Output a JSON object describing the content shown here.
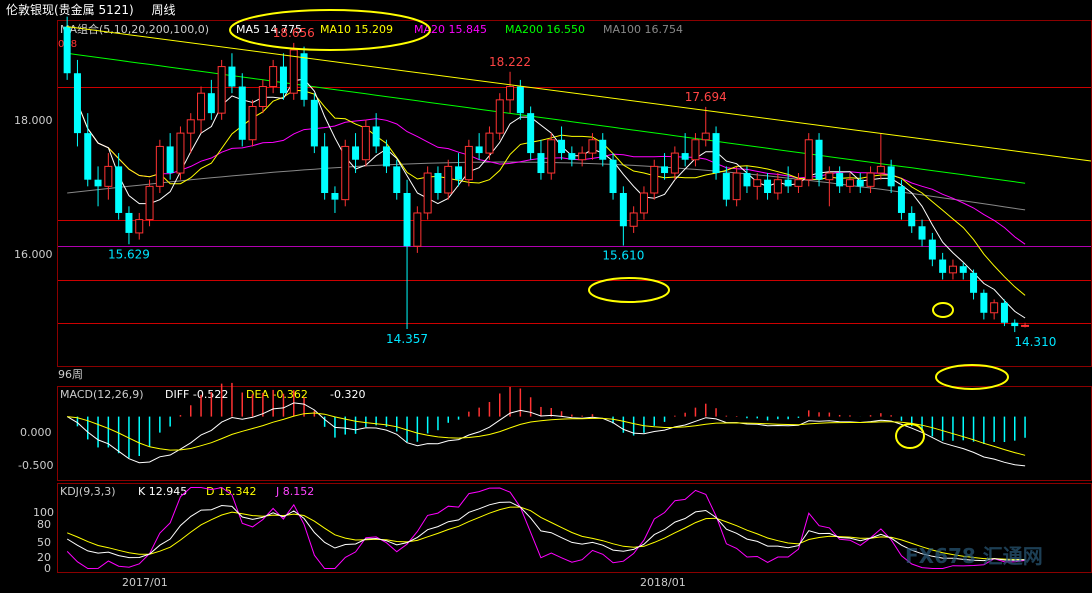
{
  "window": {
    "instrument": "伦敦银现(贵金属 5121)",
    "period": "周线"
  },
  "price_panel": {
    "ma_group_label": "MA组合(5,10,20,200,100,0)",
    "ma_values": [
      {
        "label": "MA5 14.775",
        "color": "#ffffff"
      },
      {
        "label": "MA10 15.209",
        "color": "#ffff00"
      },
      {
        "label": "MA20 15.845",
        "color": "#ff00ff"
      },
      {
        "label": "MA200 16.550",
        "color": "#00ff00"
      },
      {
        "label": "MA100 16.754",
        "color": "#888888"
      }
    ],
    "corner_label": "018",
    "bars_label": "96周",
    "y_ticks": [
      "18.000",
      "16.000"
    ]
  },
  "macd_panel": {
    "label": "MACD(12,26,9)",
    "diff": "DIFF -0.522",
    "dea": "DEA -0.362",
    "macd": "-0.320",
    "y_ticks": [
      "0.000",
      "-0.500"
    ]
  },
  "kdj_panel": {
    "label": "KDJ(9,3,3)",
    "k": "K 12.945",
    "d": "D 15.342",
    "j": "J 8.152",
    "y_ticks": [
      "100",
      "80",
      "50",
      "20",
      "0"
    ]
  },
  "x_axis": {
    "ticks": [
      "2017/01",
      "2018/01"
    ]
  },
  "watermark": "FX678 汇通网",
  "colors": {
    "up": "#ff3333",
    "down": "#00ffff",
    "ma5": "#ffffff",
    "ma10": "#ffff00",
    "ma20": "#ff00ff",
    "ma200": "#00ff00",
    "ma100": "#888888",
    "ref_line": "#cc0000"
  },
  "chart_data": {
    "type": "candlestick",
    "x_range": [
      "2016/09",
      "2018/07"
    ],
    "price_ylim": [
      13.8,
      19.0
    ],
    "horizontal_lines": [
      18.0,
      16.0,
      15.6,
      15.1,
      14.45
    ],
    "annotations": [
      {
        "text": "18.656",
        "kind": "high",
        "value": 18.656,
        "index": 22
      },
      {
        "text": "18.222",
        "kind": "high",
        "value": 18.222,
        "index": 43
      },
      {
        "text": "17.694",
        "kind": "high",
        "value": 17.694,
        "index": 62
      },
      {
        "text": "15.629",
        "kind": "low",
        "value": 15.629,
        "index": 6
      },
      {
        "text": "14.357",
        "kind": "low",
        "value": 14.357,
        "index": 33
      },
      {
        "text": "15.610",
        "kind": "low",
        "value": 15.61,
        "index": 54
      },
      {
        "text": "14.310",
        "kind": "low",
        "value": 14.31,
        "index": 94
      }
    ],
    "ohlc": [
      [
        18.9,
        19.05,
        18.1,
        18.2
      ],
      [
        18.2,
        18.4,
        17.1,
        17.3
      ],
      [
        17.3,
        17.6,
        16.5,
        16.6
      ],
      [
        16.6,
        16.8,
        16.2,
        16.5
      ],
      [
        16.5,
        17.0,
        16.3,
        16.8
      ],
      [
        16.8,
        17.0,
        16.0,
        16.1
      ],
      [
        16.1,
        16.2,
        15.63,
        15.8
      ],
      [
        15.8,
        16.1,
        15.7,
        16.0
      ],
      [
        16.0,
        16.6,
        15.9,
        16.5
      ],
      [
        16.5,
        17.2,
        16.4,
        17.1
      ],
      [
        17.1,
        17.3,
        16.6,
        16.7
      ],
      [
        16.7,
        17.4,
        16.6,
        17.3
      ],
      [
        17.3,
        17.6,
        17.0,
        17.5
      ],
      [
        17.5,
        18.0,
        17.3,
        17.9
      ],
      [
        17.9,
        18.1,
        17.5,
        17.6
      ],
      [
        17.6,
        18.4,
        17.5,
        18.3
      ],
      [
        18.3,
        18.5,
        17.9,
        18.0
      ],
      [
        18.0,
        18.2,
        17.1,
        17.2
      ],
      [
        17.2,
        17.8,
        17.1,
        17.7
      ],
      [
        17.7,
        18.1,
        17.6,
        18.0
      ],
      [
        18.0,
        18.4,
        17.9,
        18.3
      ],
      [
        18.3,
        18.5,
        17.8,
        17.9
      ],
      [
        17.9,
        18.656,
        17.8,
        18.55
      ],
      [
        18.5,
        18.6,
        17.7,
        17.8
      ],
      [
        17.8,
        17.9,
        17.0,
        17.1
      ],
      [
        17.1,
        17.3,
        16.3,
        16.4
      ],
      [
        16.4,
        16.5,
        16.1,
        16.3
      ],
      [
        16.3,
        17.2,
        16.2,
        17.1
      ],
      [
        17.1,
        17.3,
        16.7,
        16.9
      ],
      [
        16.9,
        17.5,
        16.8,
        17.4
      ],
      [
        17.4,
        17.6,
        17.0,
        17.1
      ],
      [
        17.1,
        17.2,
        16.7,
        16.8
      ],
      [
        16.8,
        16.9,
        16.3,
        16.4
      ],
      [
        16.4,
        16.6,
        14.357,
        15.6
      ],
      [
        15.6,
        16.2,
        15.5,
        16.1
      ],
      [
        16.1,
        16.8,
        16.0,
        16.7
      ],
      [
        16.7,
        16.8,
        16.3,
        16.4
      ],
      [
        16.4,
        16.9,
        16.3,
        16.8
      ],
      [
        16.8,
        17.0,
        16.5,
        16.6
      ],
      [
        16.6,
        17.2,
        16.5,
        17.1
      ],
      [
        17.1,
        17.3,
        16.9,
        17.0
      ],
      [
        17.0,
        17.4,
        16.9,
        17.3
      ],
      [
        17.3,
        17.9,
        17.2,
        17.8
      ],
      [
        17.8,
        18.222,
        17.6,
        18.0
      ],
      [
        18.0,
        18.1,
        17.5,
        17.6
      ],
      [
        17.6,
        17.7,
        16.9,
        17.0
      ],
      [
        17.0,
        17.2,
        16.6,
        16.7
      ],
      [
        16.7,
        17.3,
        16.6,
        17.2
      ],
      [
        17.2,
        17.4,
        16.9,
        17.0
      ],
      [
        17.0,
        17.1,
        16.8,
        16.9
      ],
      [
        16.9,
        17.1,
        16.8,
        17.0
      ],
      [
        17.0,
        17.3,
        16.9,
        17.2
      ],
      [
        17.2,
        17.3,
        16.8,
        16.9
      ],
      [
        16.9,
        17.0,
        16.3,
        16.4
      ],
      [
        16.4,
        16.5,
        15.61,
        15.9
      ],
      [
        15.9,
        16.2,
        15.8,
        16.1
      ],
      [
        16.1,
        16.5,
        16.0,
        16.4
      ],
      [
        16.4,
        16.9,
        16.3,
        16.8
      ],
      [
        16.8,
        17.0,
        16.6,
        16.7
      ],
      [
        16.7,
        17.1,
        16.6,
        17.0
      ],
      [
        17.0,
        17.3,
        16.8,
        16.9
      ],
      [
        16.9,
        17.3,
        16.8,
        17.2
      ],
      [
        17.2,
        17.694,
        17.1,
        17.3
      ],
      [
        17.3,
        17.4,
        16.6,
        16.7
      ],
      [
        16.7,
        16.8,
        16.2,
        16.3
      ],
      [
        16.3,
        16.8,
        16.2,
        16.7
      ],
      [
        16.7,
        16.8,
        16.4,
        16.5
      ],
      [
        16.5,
        16.7,
        16.3,
        16.6
      ],
      [
        16.6,
        16.7,
        16.3,
        16.4
      ],
      [
        16.4,
        16.7,
        16.3,
        16.6
      ],
      [
        16.6,
        16.8,
        16.4,
        16.5
      ],
      [
        16.5,
        16.7,
        16.4,
        16.6
      ],
      [
        16.6,
        17.3,
        16.5,
        17.2
      ],
      [
        17.2,
        17.3,
        16.5,
        16.6
      ],
      [
        16.6,
        16.8,
        16.2,
        16.7
      ],
      [
        16.7,
        16.8,
        16.4,
        16.5
      ],
      [
        16.5,
        16.7,
        16.4,
        16.6
      ],
      [
        16.6,
        16.7,
        16.4,
        16.5
      ],
      [
        16.5,
        16.8,
        16.4,
        16.7
      ],
      [
        16.7,
        17.3,
        16.6,
        16.8
      ],
      [
        16.8,
        16.9,
        16.4,
        16.5
      ],
      [
        16.5,
        16.6,
        16.0,
        16.1
      ],
      [
        16.1,
        16.2,
        15.8,
        15.9
      ],
      [
        15.9,
        16.0,
        15.6,
        15.7
      ],
      [
        15.7,
        15.8,
        15.3,
        15.4
      ],
      [
        15.4,
        15.5,
        15.1,
        15.2
      ],
      [
        15.2,
        15.4,
        15.1,
        15.3
      ],
      [
        15.3,
        15.35,
        15.1,
        15.2
      ],
      [
        15.2,
        15.25,
        14.8,
        14.9
      ],
      [
        14.9,
        14.95,
        14.5,
        14.6
      ],
      [
        14.6,
        14.8,
        14.5,
        14.75
      ],
      [
        14.75,
        14.8,
        14.4,
        14.45
      ],
      [
        14.45,
        14.5,
        14.31,
        14.4
      ],
      [
        14.4,
        14.45,
        14.38,
        14.41
      ]
    ],
    "trendline": {
      "from": [
        0,
        18.9
      ],
      "to": [
        96,
        16.95
      ]
    },
    "macd": {
      "ylim": [
        -0.75,
        0.35
      ]
    },
    "kdj": {
      "ylim": [
        -10,
        115
      ]
    }
  }
}
